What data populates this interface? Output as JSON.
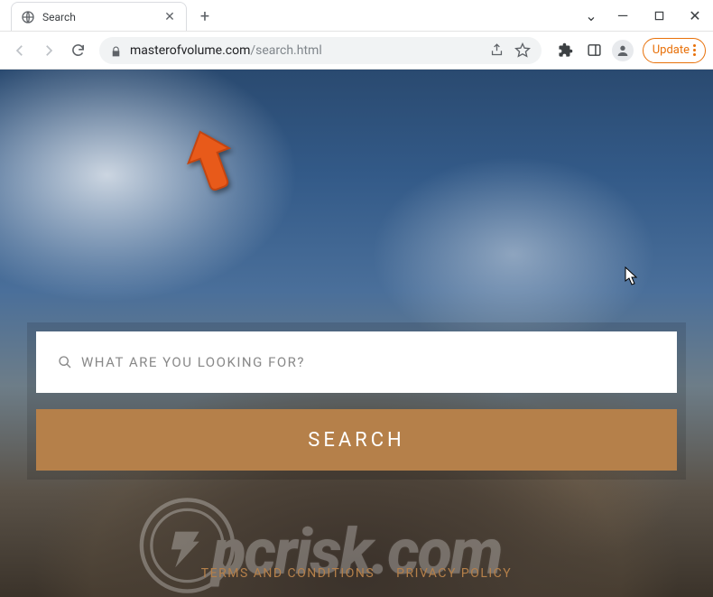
{
  "window": {
    "tab_title": "Search",
    "controls": {
      "chevron": "⌄",
      "minimize": "—",
      "maximize": "▢",
      "close": "✕"
    }
  },
  "toolbar": {
    "url_host": "masterofvolume.com",
    "url_path": "/search.html",
    "update_label": "Update"
  },
  "search": {
    "placeholder": "WHAT ARE YOU LOOKING FOR?",
    "button_label": "SEARCH"
  },
  "footer": {
    "terms_label": "TERMS AND CONDITIONS",
    "privacy_label": "PRIVACY POLICY"
  },
  "watermark": {
    "text": "pcrisk.com"
  },
  "colors": {
    "accent": "#b5804a",
    "update": "#e8710a"
  }
}
